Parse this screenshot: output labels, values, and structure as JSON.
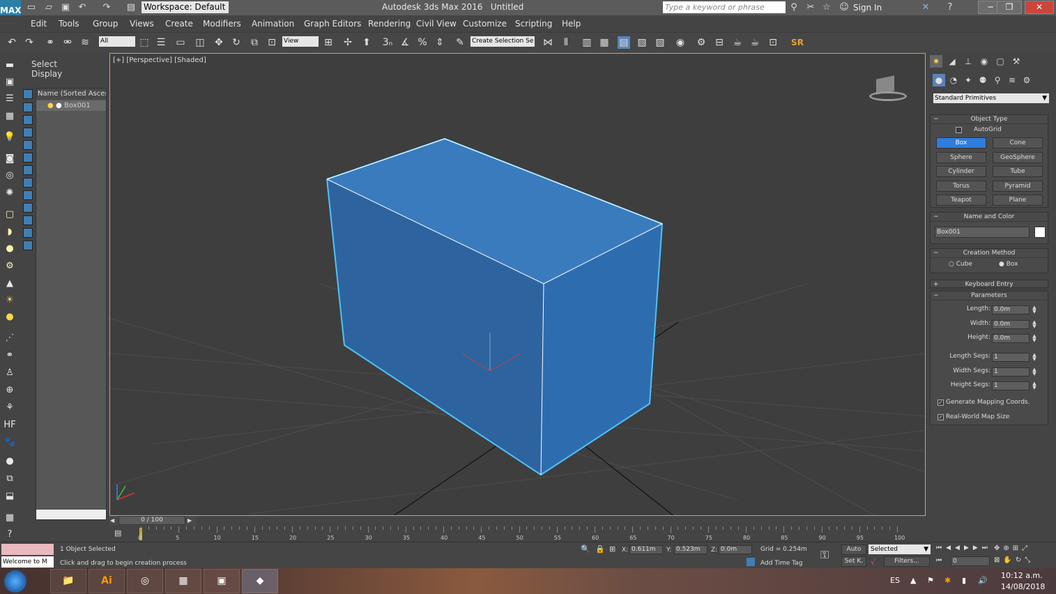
{
  "title_bar": {
    "logo": "MAX",
    "workspace": "Workspace: Default",
    "app_title": "Autodesk 3ds Max 2016",
    "doc_title": "Untitled",
    "search_placeholder": "Type a keyword or phrase",
    "sign_in": "Sign In"
  },
  "menu": [
    "Edit",
    "Tools",
    "Group",
    "Views",
    "Create",
    "Modifiers",
    "Animation",
    "Graph Editors",
    "Rendering",
    "Civil View",
    "Customize",
    "Scripting",
    "Help"
  ],
  "toolbar": {
    "filter_value": "All",
    "ref_coord_value": "View",
    "selection_set_value": "Create Selection Se",
    "sr_label": "SR"
  },
  "scene_explorer": {
    "tab_select": "Select",
    "tab_display": "Display",
    "column_header": "Name (Sorted Ascend",
    "object_name": "Box001"
  },
  "viewport": {
    "label": "[+] [Perspective] [Shaded]",
    "box_color": "#3c7ec0",
    "edge_color": "#4fc3f7"
  },
  "command_panel": {
    "dropdown": "Standard Primitives",
    "object_type_title": "Object Type",
    "autogrid": "AutoGrid",
    "buttons": [
      "Box",
      "Cone",
      "Sphere",
      "GeoSphere",
      "Cylinder",
      "Tube",
      "Torus",
      "Pyramid",
      "Teapot",
      "Plane"
    ],
    "active_button": "Box",
    "name_color_title": "Name and Color",
    "name_value": "Box001",
    "creation_method_title": "Creation Method",
    "creation_cube": "Cube",
    "creation_box": "Box",
    "keyboard_entry_title": "Keyboard Entry",
    "parameters_title": "Parameters",
    "params": [
      {
        "label": "Length:",
        "value": "0.0m"
      },
      {
        "label": "Width:",
        "value": "0.0m"
      },
      {
        "label": "Height:",
        "value": "0.0m"
      }
    ],
    "segs": [
      {
        "label": "Length Segs:",
        "value": "1"
      },
      {
        "label": "Width Segs:",
        "value": "1"
      },
      {
        "label": "Height Segs:",
        "value": "1"
      }
    ],
    "gen_mapping": "Generate Mapping Coords.",
    "real_world": "Real-World Map Size"
  },
  "timeline": {
    "slider_label": "0 / 100",
    "ticks": [
      "0",
      "5",
      "10",
      "15",
      "20",
      "25",
      "30",
      "35",
      "40",
      "45",
      "50",
      "55",
      "60",
      "65",
      "70",
      "75",
      "80",
      "85",
      "90",
      "95",
      "100"
    ]
  },
  "status": {
    "script_text": "Welcome to M",
    "selected_text": "1 Object Selected",
    "prompt_text": "Click and drag to begin creation process",
    "x_label": "X:",
    "x_value": "0.611m",
    "y_label": "Y:",
    "y_value": "0.523m",
    "z_label": "Z:",
    "z_value": "0.0m",
    "grid_text": "Grid = 0.254m",
    "add_time_tag": "Add Time Tag",
    "auto_label": "Auto",
    "set_key_label": "Set K.",
    "selected_dropdown": "Selected",
    "filters_label": "Filters...",
    "frame_value": "0"
  },
  "taskbar": {
    "lang": "ES",
    "time": "10:12 a.m.",
    "date": "14/08/2018"
  }
}
